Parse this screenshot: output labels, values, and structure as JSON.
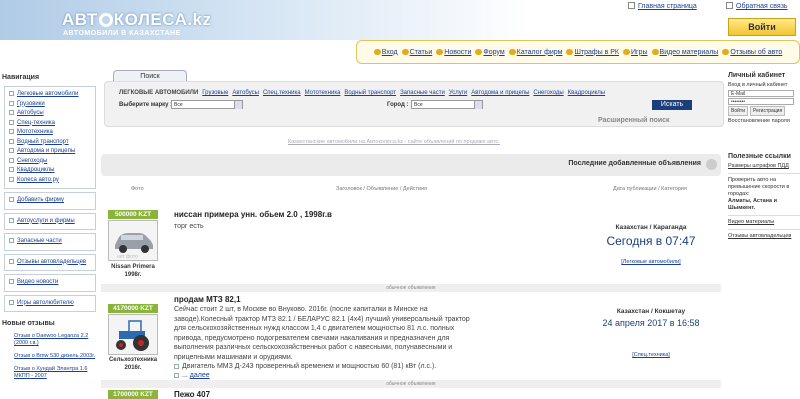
{
  "header": {
    "logo": "АВТОКОЛЕСА.kz",
    "logo_part1": "АВТ",
    "logo_part2": "КОЛЕСА.kz",
    "slogan": "АВТОМОБИЛИ В КАЗАХСТАНЕ",
    "home_link": "Главная страница",
    "feedback_link": "Обратная связь",
    "login_button": "Войти"
  },
  "topnav": [
    "Вход",
    "Статьи",
    "Новости",
    "Форум",
    "Каталог фирм",
    "Штрафы в РК",
    "Игры",
    "Видео материалы",
    "Отзывы об авто"
  ],
  "left": {
    "nav_title": "Навигация",
    "nav_items": [
      "Легковые автомобили",
      "Грузовики",
      "Автобусы",
      "Спец-техника",
      "Мототехника",
      "Водный транспорт",
      "Автодома и прицепы",
      "Снегоходы",
      "Квадроциклы",
      "Колеса авто.ру"
    ],
    "box2": [
      "Добавить фирму"
    ],
    "box3": [
      "Автоуслуги и фирмы"
    ],
    "box4": [
      "Запасные части"
    ],
    "box5": [
      "Отзывы автовладельцев"
    ],
    "box6": [
      "Видео новости"
    ],
    "box7": [
      "Игры автолюбителю"
    ],
    "reviews_title": "Новые отзывы",
    "reviews": [
      "Отзыв о Daewoo Leganza 2.2 (2000 г.в.)",
      "Отзыв о Bmw 530 дизель 2003г.",
      "Отзыв о Хундай Элантра 1.6 МКПП - 2007"
    ]
  },
  "search": {
    "tab": "Поиск",
    "categories_current": "ЛЕГКОВЫЕ АВТОМОБИЛИ",
    "categories": [
      "Грузовые",
      "Автобусы",
      "Спец.техника",
      "Мототехника",
      "Водный транспорт",
      "Запасные части",
      "Услуги",
      "Автодома и прицепы",
      "Снегоходы",
      "Квадроциклы"
    ],
    "brand_label": "Выберите марку :",
    "brand_value": "Все",
    "city_label": "Город :",
    "city_value": "Все",
    "find_button": "Искать",
    "advanced": "Расширенный поиск"
  },
  "info_line": "Казахстанские автомобили на Автоколеса.kz - сайте объявлений по продаже авто.",
  "latest": {
    "title": "Последние добавленные объявления",
    "col_photo": "Фото",
    "col_title": "Заголовок / Объявление / Действия",
    "col_date": "Дата публикации / Категория"
  },
  "listings": [
    {
      "price": "500000 KZT",
      "caption1": "Nissan Primera",
      "caption2": "1998г.",
      "title": "ниссан примера унн. обьем 2.0 , 1998г.в",
      "desc": "торг есть",
      "location": "Казахстан / Караганда",
      "date": "Сегодня в 07:47",
      "category": "[Легковые автомобили]",
      "separator": "обычное объявление"
    },
    {
      "price": "4170000 KZT",
      "caption1": "Сельхозтехника",
      "caption2": "2016г.",
      "title": "продам МТЗ 82,1",
      "desc": "Сейчас стоит 2 шт, в Москве во Внуково. 2016г. (после капиталки в Минске на заводе).Колесный трактор МТЗ 82.1 / БЕЛАРУС 82.1 (4х4) лучший универсальный трактор для сельскохозяйственных нужд классом 1,4 с двигателем мощностью 81 л.с. полных привода, предусмотрено подогревателем свечами накаливания и предназначен для выполнения различных сельскохозяйственных работ с навесными, полунавесными и прицепными машинами и орудиями.",
      "desc_extra": "Двигатель ММЗ Д-243 проверенный временем и мощностью 60 (81) кВт (л.с.).",
      "more": "далее",
      "location": "Казахстан / Кокшетау",
      "date": "24 апреля 2017 в 16:58",
      "category": "[Спец.техника]",
      "separator": "обычное объявление"
    },
    {
      "price": "1700000 KZT",
      "title": "Пежо 407"
    }
  ],
  "right": {
    "cabinet_title": "Личный кабинет",
    "login_hint": "Вход в личный кабинет",
    "email_placeholder": "E-Mail",
    "password_value": "••••••••",
    "btn_login": "Войти",
    "btn_register": "Регистрация",
    "recover": "Восстановление пароля",
    "links_title": "Полезные ссылки",
    "link1": "Размеры штрафов ПДД",
    "check_text": "Проверить авто на превышение скорости в городах:",
    "cities": "Алматы, Астана и Шымкент.",
    "video": "Видео материалы",
    "reviews": "Отзывы автовладельцев"
  },
  "colors": {
    "accent": "#8ab53a",
    "link": "#1a3f9b",
    "button": "#1a3f7a"
  }
}
